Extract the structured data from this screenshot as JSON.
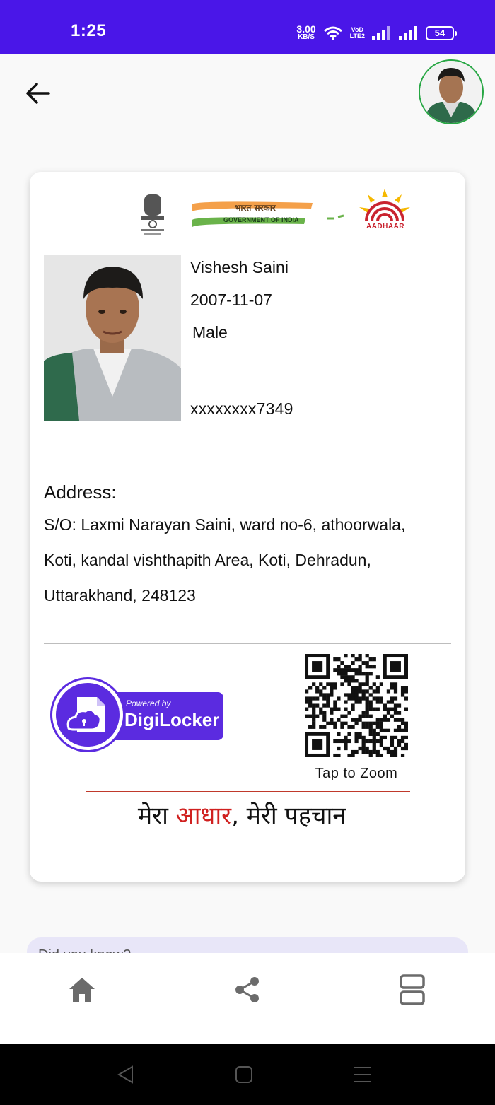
{
  "status_bar": {
    "time": "1:25",
    "net_speed_value": "3.00",
    "net_speed_unit": "KB/S",
    "volte_top": "VoD",
    "volte_bottom": "LTE2",
    "battery": "54"
  },
  "card": {
    "govt_hindi": "भारत सरकार",
    "govt_english": "GOVERNMENT OF INDIA",
    "aadhaar_logo_text": "AADHAAR",
    "name": "Vishesh Saini",
    "dob": "2007-11-07",
    "gender": "Male",
    "aadhaar_number": "xxxxxxxx7349",
    "address_title": "Address:",
    "address_lines": [
      "S/O: Laxmi Narayan Saini, ward no-6, athoorwala,",
      "Koti, kandal vishthapith Area, Koti, Dehradun,",
      "Uttarakhand, 248123"
    ],
    "digilocker_powered": "Powered by",
    "digilocker_name": "DigiLocker",
    "qr_caption": "Tap to Zoom",
    "tagline_part1": "मेरा ",
    "tagline_red": "आधार",
    "tagline_part2": ", मेरी पहचान"
  },
  "peek_card": {
    "text": "Did you know?"
  },
  "icons": {
    "back": "arrow-left-icon",
    "home": "home-icon",
    "share": "share-icon",
    "list": "list-icon"
  },
  "colors": {
    "status_bar": "#4a16e8",
    "digilocker": "#5b2be0",
    "avatar_border": "#27a744",
    "tagline_red": "#d0201f"
  }
}
